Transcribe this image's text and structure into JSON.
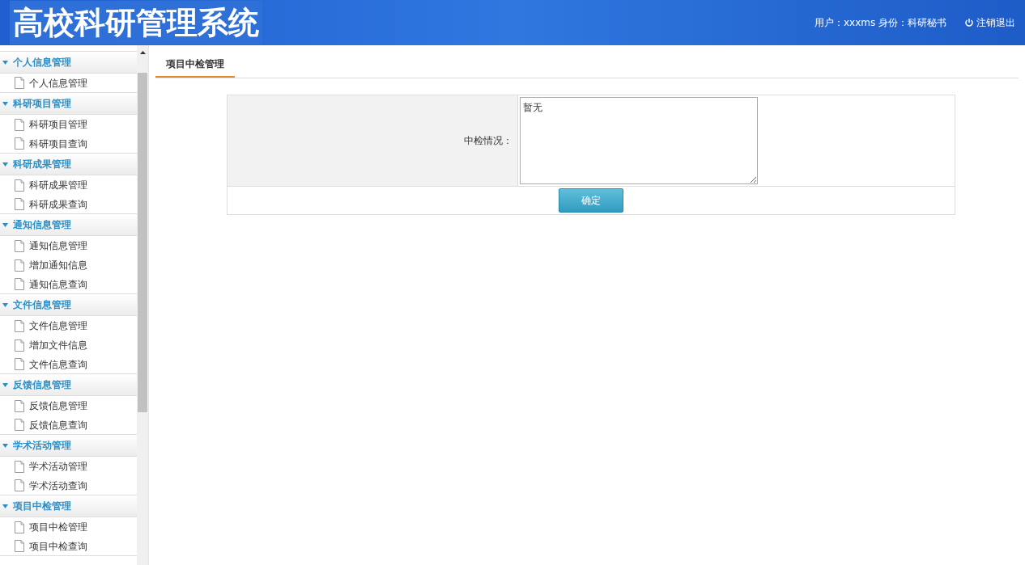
{
  "header": {
    "title": "高校科研管理系统",
    "user_info": "用户：xxxms 身份：科研秘书",
    "logout": "注销退出"
  },
  "sidebar": {
    "groups": [
      {
        "label": "个人信息管理",
        "expanded": true,
        "items": [
          "个人信息管理"
        ]
      },
      {
        "label": "科研项目管理",
        "expanded": true,
        "items": [
          "科研项目管理",
          "科研项目查询"
        ]
      },
      {
        "label": "科研成果管理",
        "expanded": true,
        "items": [
          "科研成果管理",
          "科研成果查询"
        ]
      },
      {
        "label": "通知信息管理",
        "expanded": true,
        "items": [
          "通知信息管理",
          "增加通知信息",
          "通知信息查询"
        ]
      },
      {
        "label": "文件信息管理",
        "expanded": true,
        "items": [
          "文件信息管理",
          "增加文件信息",
          "文件信息查询"
        ]
      },
      {
        "label": "反馈信息管理",
        "expanded": true,
        "items": [
          "反馈信息管理",
          "反馈信息查询"
        ]
      },
      {
        "label": "学术活动管理",
        "expanded": true,
        "items": [
          "学术活动管理",
          "学术活动查询"
        ]
      },
      {
        "label": "项目中检管理",
        "expanded": true,
        "items": [
          "项目中检管理",
          "项目中检查询"
        ]
      }
    ]
  },
  "tabs": [
    {
      "label": "项目中检管理",
      "selected": true
    }
  ],
  "form": {
    "label": "中检情况：",
    "value": "暂无",
    "submit": "确定"
  }
}
